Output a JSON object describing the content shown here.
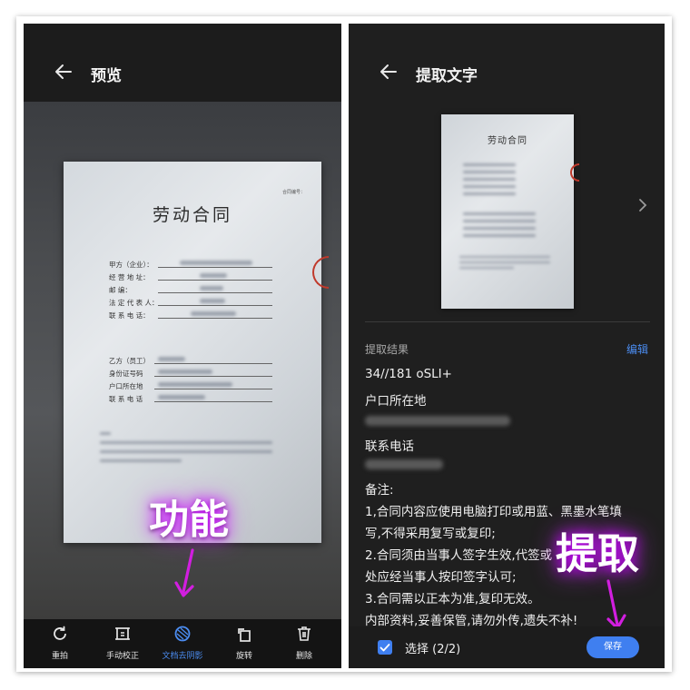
{
  "left_screen": {
    "title": "预览",
    "document": {
      "title": "劳动合同",
      "contract_no_label": "合同编号：",
      "party_a_fields": [
        "甲方（企业）：",
        "经 营 地 址：",
        "邮       编：",
        "法 定 代 表 人：",
        "联 系 电 话："
      ],
      "party_b_fields": [
        "乙方（员工）",
        "身份证号码",
        "户口所在地",
        "联 系 电 话"
      ]
    },
    "overlay_label": "功能",
    "toolbar": [
      {
        "label": "重拍",
        "icon": "retake-icon"
      },
      {
        "label": "手动校正",
        "icon": "crop-icon"
      },
      {
        "label": "文档去阴影",
        "icon": "remove-shadow-icon",
        "active": true
      },
      {
        "label": "旋转",
        "icon": "rotate-icon"
      },
      {
        "label": "删除",
        "icon": "delete-icon"
      }
    ]
  },
  "right_screen": {
    "title": "提取文字",
    "thumbnail_title": "劳动合同",
    "result_label": "提取结果",
    "edit_label": "编辑",
    "lines": [
      "34//181 oSLI+",
      "户口所在地",
      "联系电话",
      "备注:",
      "1,合同内容应使用电脑打印或用蓝、黑墨水笔填",
      "写,不得采用复写或复印;",
      "2.合同须由当事人签字生效,代签或",
      "处应经当事人按印签字认可;",
      "3.合同需以正本为准,复印无效。",
      "内部资料,妥善保管,请勿外传,遗失不补!"
    ],
    "overlay_label": "提取",
    "select_label": "选择 (2/2)",
    "save_label": "保存"
  },
  "colors": {
    "accent": "#3f7ff0",
    "overlay_glow": "#c800ff",
    "arrow": "#d21ee0"
  }
}
